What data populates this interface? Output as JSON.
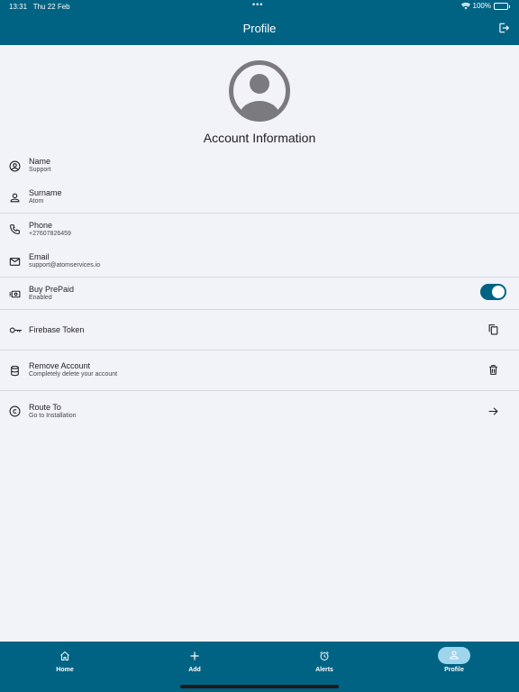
{
  "status_bar": {
    "time": "13:31",
    "date": "Thu 22 Feb",
    "dots": "•••",
    "battery": "100%"
  },
  "header": {
    "title": "Profile",
    "logout_icon": "logout-icon"
  },
  "account": {
    "title": "Account Information",
    "avatar_icon": "account-circle-icon"
  },
  "fields": {
    "name": {
      "label": "Name",
      "value": "Support"
    },
    "surname": {
      "label": "Surname",
      "value": "Atom"
    },
    "phone": {
      "label": "Phone",
      "value": "+27607826459"
    },
    "email": {
      "label": "Email",
      "value": "support@atomservices.io"
    },
    "prepaid": {
      "label": "Buy PrePaid",
      "value": "Enabled",
      "enabled": true
    },
    "firebase": {
      "label": "Firebase Token"
    },
    "remove": {
      "label": "Remove Account",
      "value": "Completely delete your account"
    },
    "route": {
      "label": "Route To",
      "value": "Go to Installation"
    }
  },
  "nav": {
    "home": "Home",
    "add": "Add",
    "alerts": "Alerts",
    "profile": "Profile"
  },
  "colors": {
    "primary": "#006384",
    "background": "#f2f2f9",
    "nav_active_pill": "#9fd5ec"
  }
}
